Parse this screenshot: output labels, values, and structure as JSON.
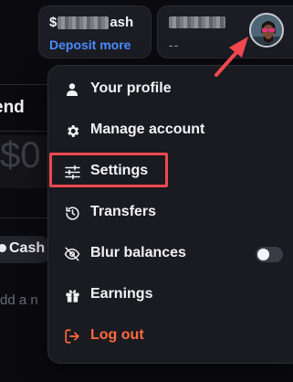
{
  "topbar": {
    "cash_prefix": "$",
    "cash_suffix": "ash",
    "deposit_label": "Deposit more",
    "balance_value": "--"
  },
  "background": {
    "section_title": "end",
    "amount": "$0",
    "cash_label": "Cash",
    "add_placeholder": "dd a n"
  },
  "menu": {
    "items": [
      {
        "label": "Your profile",
        "icon": "person-icon"
      },
      {
        "label": "Manage account",
        "icon": "gear-icon"
      },
      {
        "label": "Settings",
        "icon": "sliders-icon"
      },
      {
        "label": "Transfers",
        "icon": "history-icon"
      },
      {
        "label": "Blur balances",
        "icon": "eye-off-icon",
        "toggle": false
      },
      {
        "label": "Earnings",
        "icon": "gift-icon"
      },
      {
        "label": "Log out",
        "icon": "logout-icon"
      }
    ]
  },
  "colors": {
    "accent_link": "#4d8dff",
    "logout": "#ff6a3d",
    "highlight": "#f0484e"
  }
}
